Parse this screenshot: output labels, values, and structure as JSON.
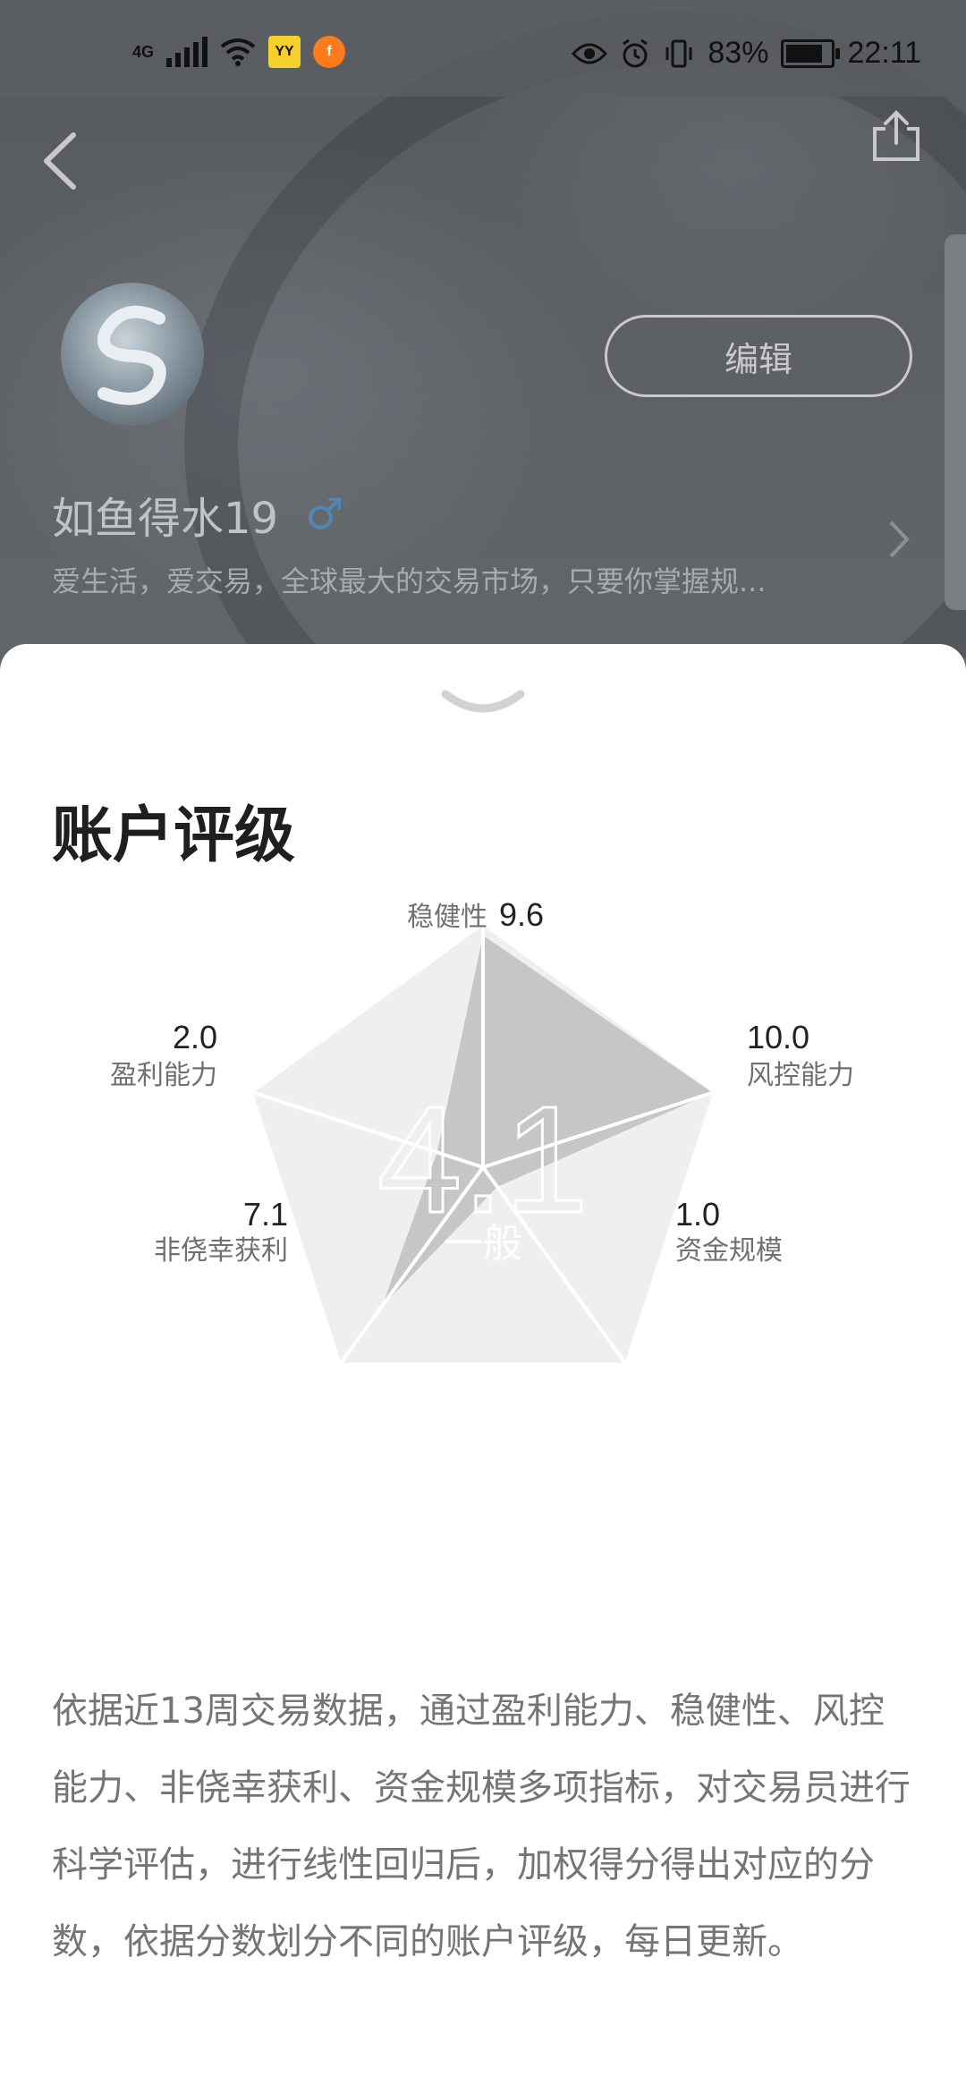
{
  "status_bar": {
    "network": "4G",
    "app_icons": [
      "yy-icon",
      "app-f-icon"
    ],
    "battery": "83%",
    "battery_level": 0.83,
    "time": "22:11"
  },
  "profile": {
    "username": "如鱼得水19",
    "gender_symbol": "♂",
    "bio": "爱生活，爱交易，全球最大的交易市场，只要你掌握规...",
    "edit_label": "编辑"
  },
  "sheet": {
    "title": "账户评级",
    "center_score": "4.1",
    "center_grade": "一般",
    "description": "依据近13周交易数据，通过盈利能力、稳健性、风控能力、非侥幸获利、资金规模多项指标，对交易员进行科学评估，进行线性回归后，加权得分得出对应的分数，依据分数划分不同的账户评级，每日更新。"
  },
  "chart_data": {
    "type": "radar",
    "max": 10,
    "axes": [
      {
        "label": "稳健性",
        "value": 9.6,
        "value_text": "9.6"
      },
      {
        "label": "风控能力",
        "value": 10.0,
        "value_text": "10.0"
      },
      {
        "label": "资金规模",
        "value": 1.0,
        "value_text": "1.0"
      },
      {
        "label": "非侥幸获利",
        "value": 7.1,
        "value_text": "7.1"
      },
      {
        "label": "盈利能力",
        "value": 2.0,
        "value_text": "2.0"
      }
    ],
    "colors": {
      "outer": "#efefef",
      "fill": "#c6c6c6",
      "spokes": "#ffffff"
    }
  }
}
